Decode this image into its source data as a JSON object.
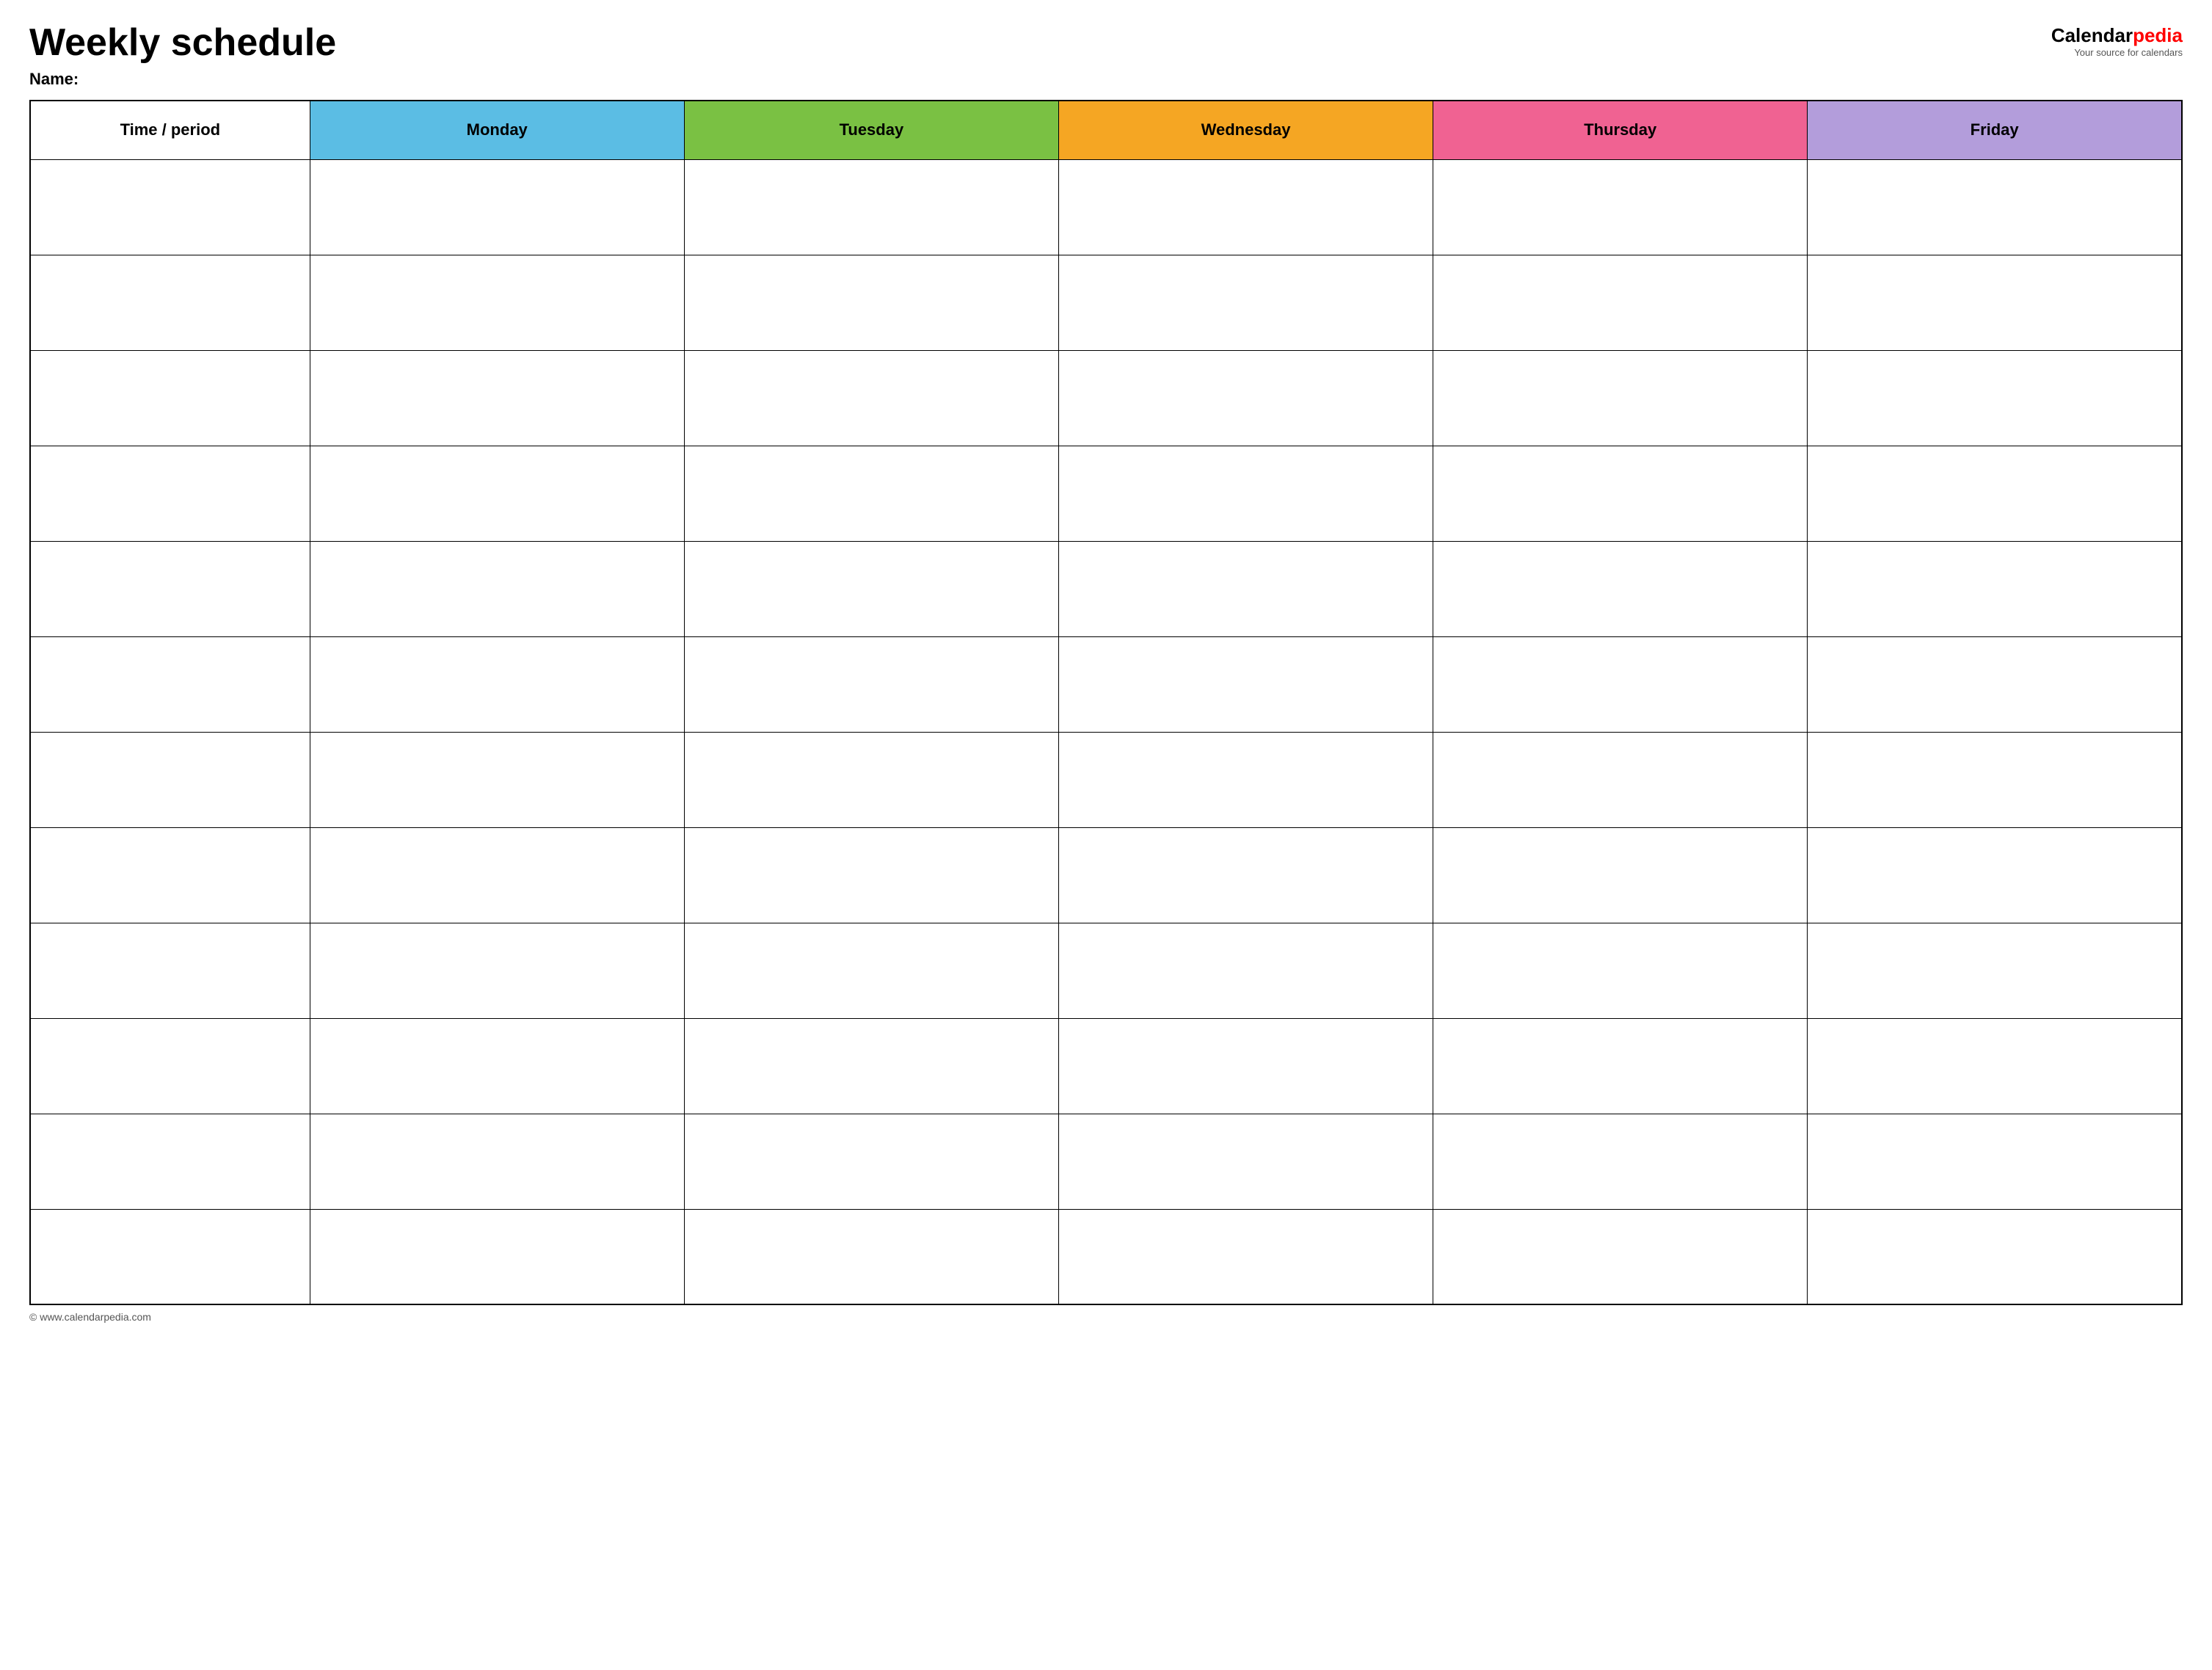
{
  "header": {
    "title": "Weekly schedule",
    "name_label": "Name:",
    "logo": {
      "calendar_part": "Calendar",
      "pedia_part": "pedia",
      "tagline": "Your source for calendars"
    }
  },
  "table": {
    "columns": [
      {
        "id": "time",
        "label": "Time / period",
        "color": "#ffffff"
      },
      {
        "id": "monday",
        "label": "Monday",
        "color": "#5bbde4"
      },
      {
        "id": "tuesday",
        "label": "Tuesday",
        "color": "#7ac143"
      },
      {
        "id": "wednesday",
        "label": "Wednesday",
        "color": "#f5a623"
      },
      {
        "id": "thursday",
        "label": "Thursday",
        "color": "#f06292"
      },
      {
        "id": "friday",
        "label": "Friday",
        "color": "#b39ddb"
      }
    ],
    "rows": 12
  },
  "footer": {
    "copyright": "© www.calendarpedia.com"
  }
}
